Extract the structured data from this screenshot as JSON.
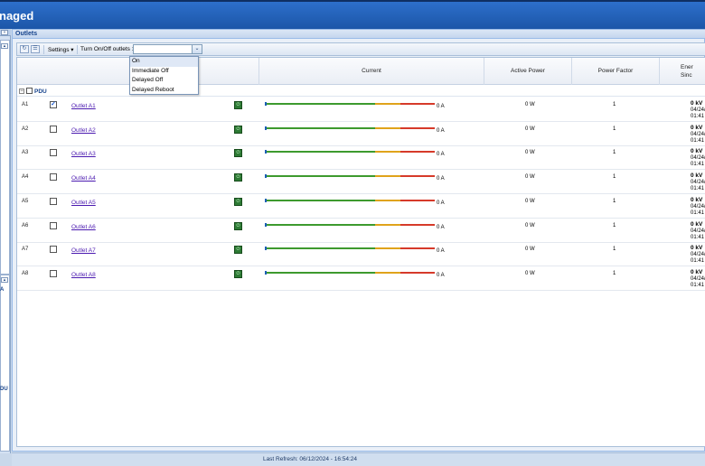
{
  "banner": {
    "title": "naged"
  },
  "leftnav": {
    "collapse_top": "«",
    "collapse_mid": "▴",
    "pane1_icon": "▴",
    "pane2_icon": "▴",
    "text_a": "A",
    "text_du": "DU"
  },
  "panel": {
    "title": "Outlets"
  },
  "toolbar": {
    "icon1": "refresh-icon",
    "icon2": "list-icon",
    "settings_label": "Settings ▾",
    "onoff_label": "Turn On/Off outlets :",
    "combo_value": "",
    "combo_arrow": "⌄"
  },
  "dropdown": {
    "options": [
      "On",
      "Immediate Off",
      "Delayed Off",
      "Delayed Reboot"
    ]
  },
  "grid": {
    "columns": [
      "",
      "Current",
      "Active Power",
      "Power Factor",
      "Ener\nSinc"
    ],
    "col_current": "Current",
    "col_power": "Active Power",
    "col_pf": "Power Factor",
    "col_energy_1": "Ener",
    "col_energy_2": "Sinc",
    "group_label": "PDU",
    "group_toggle": "⊟",
    "rows": [
      {
        "id": "A1",
        "checked": true,
        "name": "Outlet A1",
        "amps": "0 A",
        "power": "0 W",
        "pf": "1",
        "energy": "0 kV",
        "date": "04/24/",
        "time": "01:41"
      },
      {
        "id": "A2",
        "checked": false,
        "name": "Outlet A2",
        "amps": "0 A",
        "power": "0 W",
        "pf": "1",
        "energy": "0 kV",
        "date": "04/24/",
        "time": "01:41"
      },
      {
        "id": "A3",
        "checked": false,
        "name": "Outlet A3",
        "amps": "0 A",
        "power": "0 W",
        "pf": "1",
        "energy": "0 kV",
        "date": "04/24/",
        "time": "01:41"
      },
      {
        "id": "A4",
        "checked": false,
        "name": "Outlet A4",
        "amps": "0 A",
        "power": "0 W",
        "pf": "1",
        "energy": "0 kV",
        "date": "04/24/",
        "time": "01:41"
      },
      {
        "id": "A5",
        "checked": false,
        "name": "Outlet A5",
        "amps": "0 A",
        "power": "0 W",
        "pf": "1",
        "energy": "0 kV",
        "date": "04/24/",
        "time": "01:41"
      },
      {
        "id": "A6",
        "checked": false,
        "name": "Outlet A6",
        "amps": "0 A",
        "power": "0 W",
        "pf": "1",
        "energy": "0 kV",
        "date": "04/24/",
        "time": "01:41"
      },
      {
        "id": "A7",
        "checked": false,
        "name": "Outlet A7",
        "amps": "0 A",
        "power": "0 W",
        "pf": "1",
        "energy": "0 kV",
        "date": "04/24/",
        "time": "01:41"
      },
      {
        "id": "A8",
        "checked": false,
        "name": "Outlet A8",
        "amps": "0 A",
        "power": "0 W",
        "pf": "1",
        "energy": "0 kV",
        "date": "04/24/",
        "time": "01:41"
      }
    ]
  },
  "status": {
    "text": "Last Refresh: 06/12/2024 - 16:54:24"
  },
  "colors": {
    "banner": "#1c56a8",
    "link": "#4b1ab0",
    "bar_green": "#3d9a2e",
    "bar_yellow": "#e0a31b",
    "bar_red": "#d63a2a"
  }
}
